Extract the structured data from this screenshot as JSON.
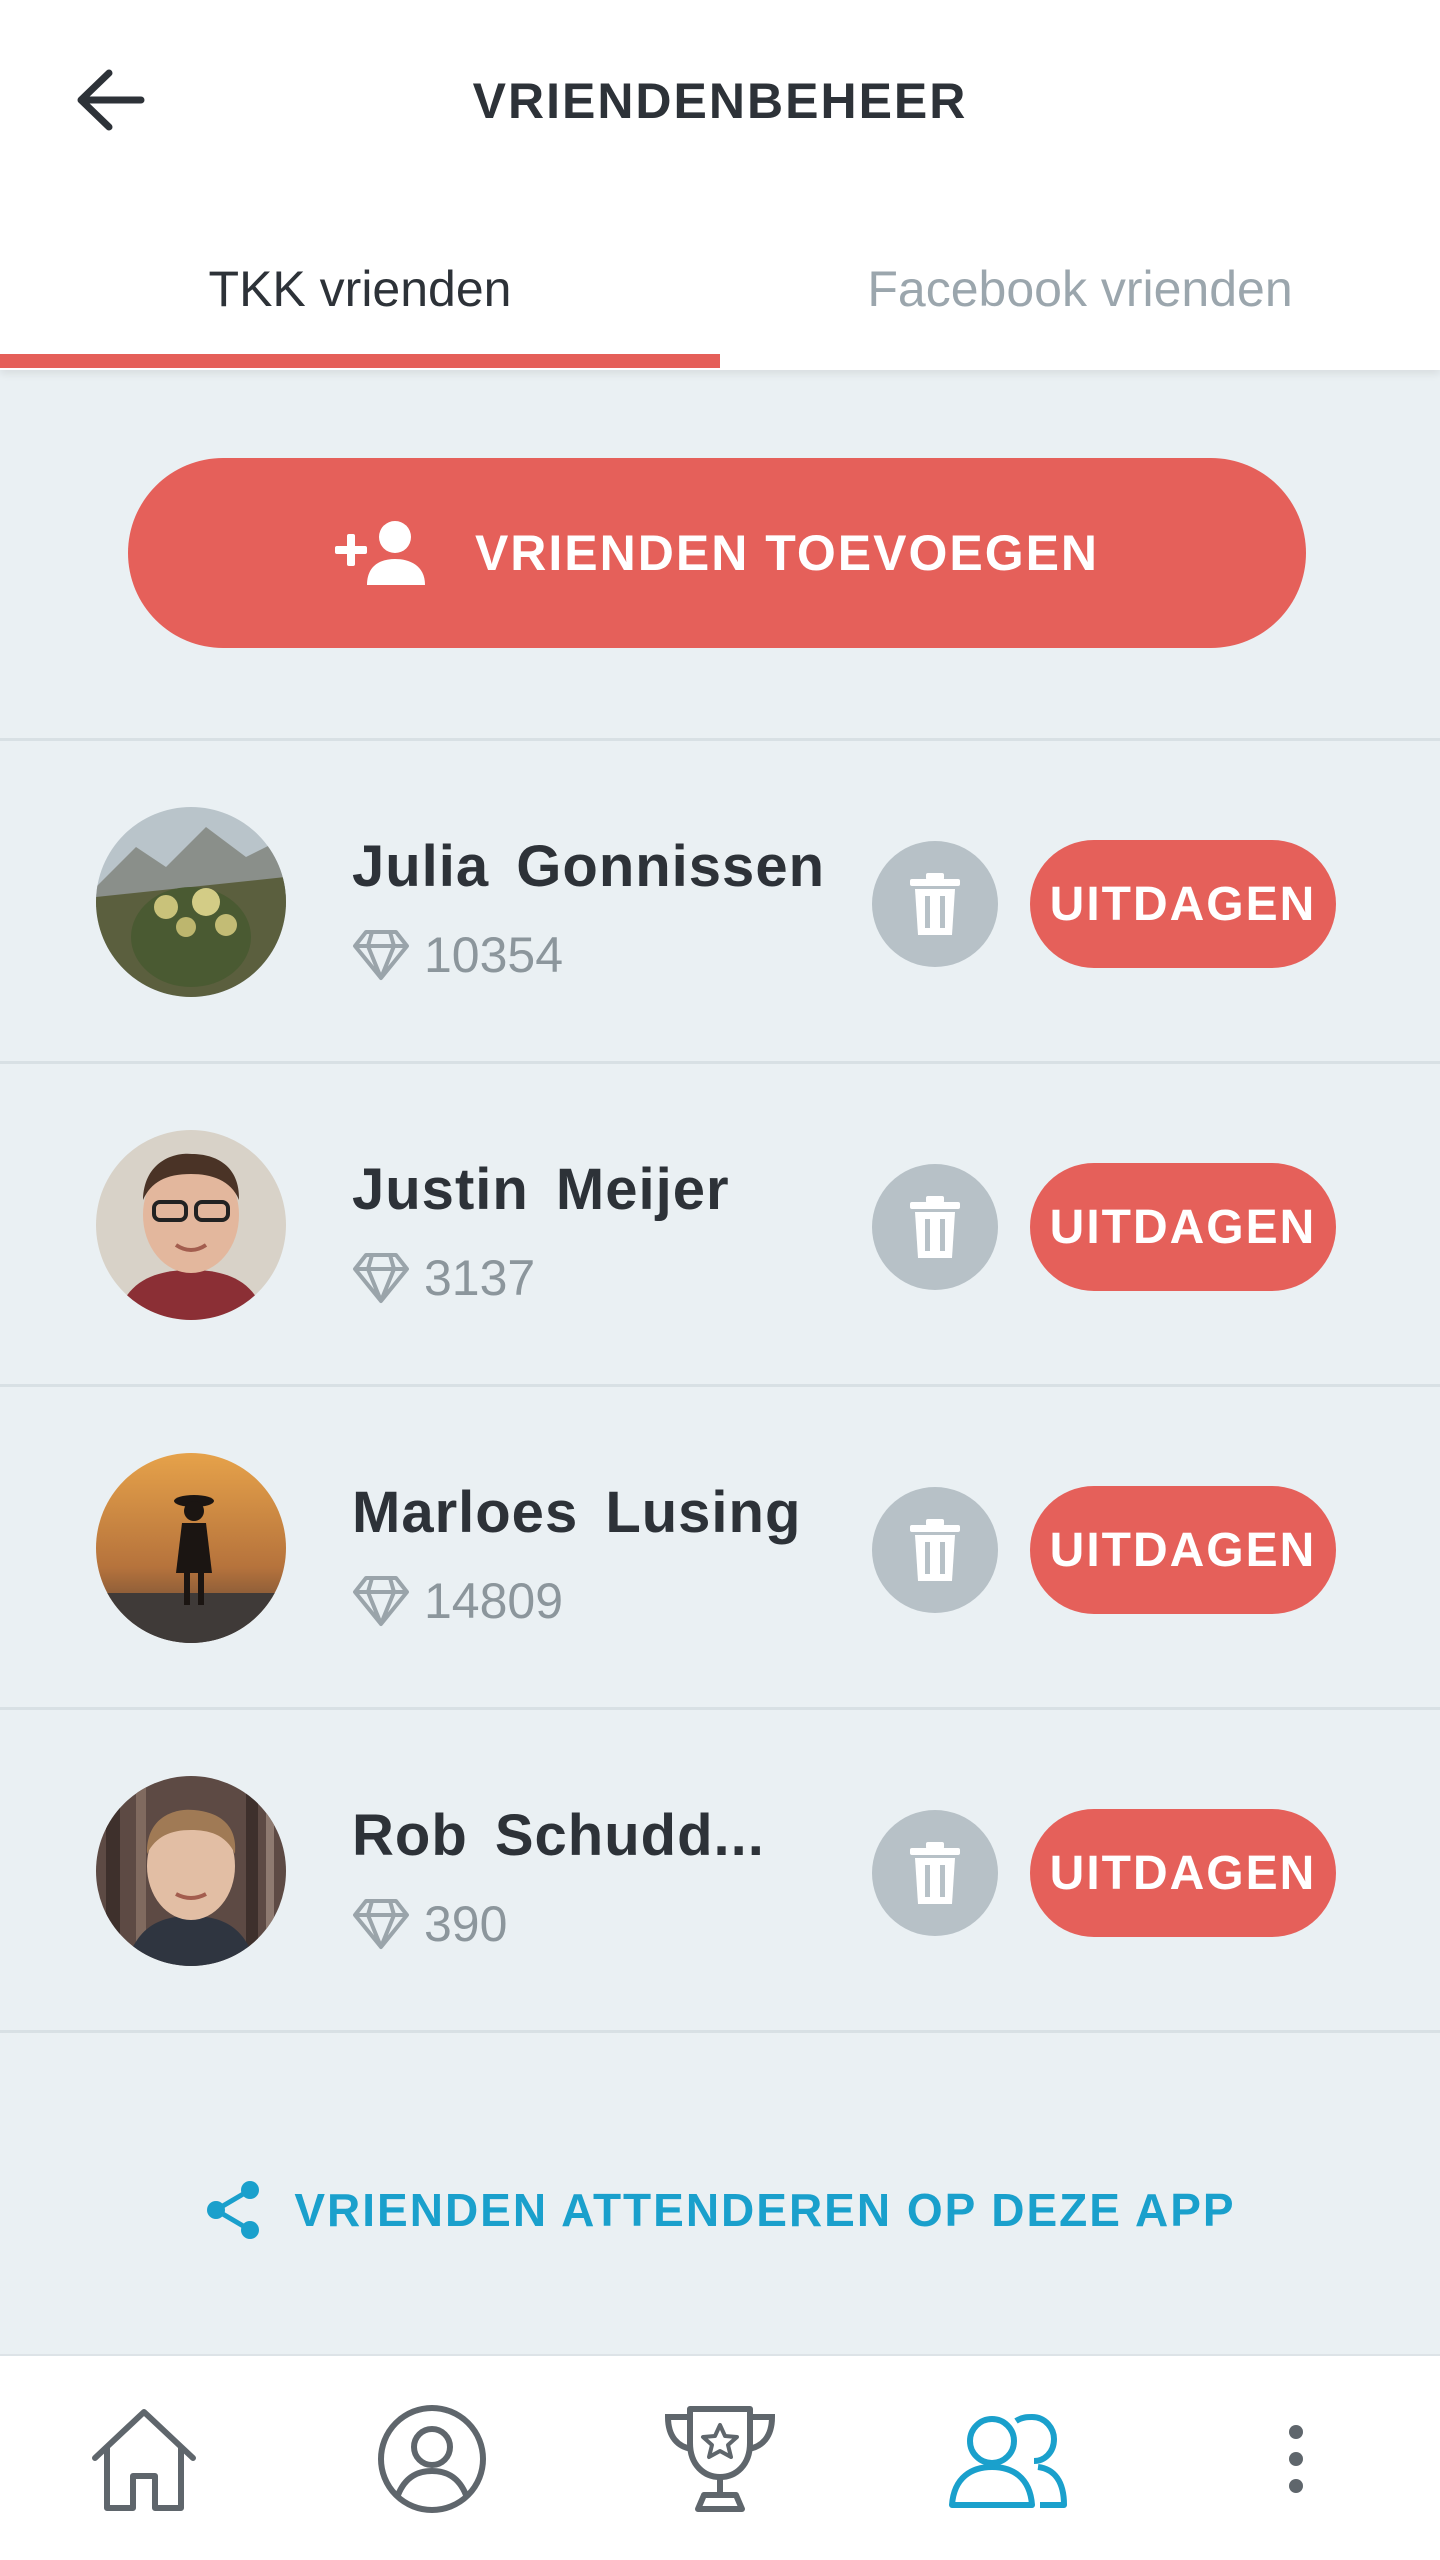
{
  "header": {
    "title": "VRIENDENBEHEER",
    "tabs": [
      {
        "label": "TKK vrienden",
        "active": true
      },
      {
        "label": "Facebook vrienden",
        "active": false
      }
    ]
  },
  "add_friends": {
    "label": "VRIENDEN TOEVOEGEN",
    "icon": "add-person-icon"
  },
  "friends": [
    {
      "name": "Julia  Gonnissen",
      "score": "10354",
      "challenge_label": "UITDAGEN"
    },
    {
      "name": "Justin  Meijer",
      "score": "3137",
      "challenge_label": "UITDAGEN"
    },
    {
      "name": "Marloes  Lusing",
      "score": "14809",
      "challenge_label": "UITDAGEN"
    },
    {
      "name": "Rob  Schudd...",
      "score": "390",
      "challenge_label": "UITDAGEN"
    }
  ],
  "share": {
    "label": "VRIENDEN ATTENDEREN OP DEZE APP",
    "icon": "share-icon"
  },
  "bottom_nav": {
    "items": [
      "home-icon",
      "profile-icon",
      "trophy-icon",
      "friends-icon",
      "more-icon"
    ],
    "active": "friends-icon"
  },
  "colors": {
    "accent": "#e5605a",
    "link": "#1aa0cc",
    "background": "#eaf0f3",
    "text": "#2d3238",
    "muted": "#9ba6ad",
    "delete_bg": "#b7c1c7"
  }
}
